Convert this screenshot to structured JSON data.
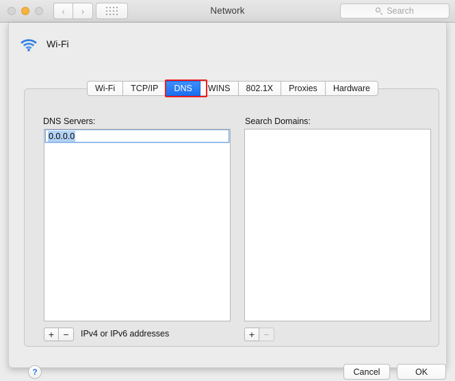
{
  "window": {
    "title": "Network",
    "traffic_lights": [
      "close",
      "minimize",
      "zoom"
    ],
    "nav_back": "‹",
    "nav_forward": "›",
    "grid_icon": "show-all-grid-icon",
    "search": {
      "placeholder": "Search",
      "value": "",
      "icon": "search-icon"
    }
  },
  "sheet": {
    "service": {
      "icon": "wifi-icon",
      "name": "Wi-Fi"
    },
    "tabs": [
      {
        "label": "Wi-Fi",
        "selected": false
      },
      {
        "label": "TCP/IP",
        "selected": false
      },
      {
        "label": "DNS",
        "selected": true
      },
      {
        "label": "WINS",
        "selected": false
      },
      {
        "label": "802.1X",
        "selected": false
      },
      {
        "label": "Proxies",
        "selected": false
      },
      {
        "label": "Hardware",
        "selected": false
      }
    ],
    "highlight": {
      "target": "DNS",
      "color": "#ef1a1a"
    },
    "dns_servers": {
      "label": "DNS Servers:",
      "entries": [
        "0.0.0.0"
      ],
      "editing_value": "0.0.0.0",
      "add_label": "+",
      "remove_label": "−",
      "add_enabled": true,
      "remove_enabled": true,
      "hint": "IPv4 or IPv6 addresses"
    },
    "search_domains": {
      "label": "Search Domains:",
      "entries": [],
      "add_label": "+",
      "remove_label": "−",
      "add_enabled": true,
      "remove_enabled": false
    },
    "footer": {
      "help_label": "?",
      "cancel_label": "Cancel",
      "ok_label": "OK"
    }
  },
  "colors": {
    "selection_blue": "#1a6ff0",
    "row_selection": "#b5d3f7",
    "highlight_red": "#ef1a1a",
    "wifi_blue": "#2f7fe0",
    "help_blue": "#2a72e0"
  }
}
